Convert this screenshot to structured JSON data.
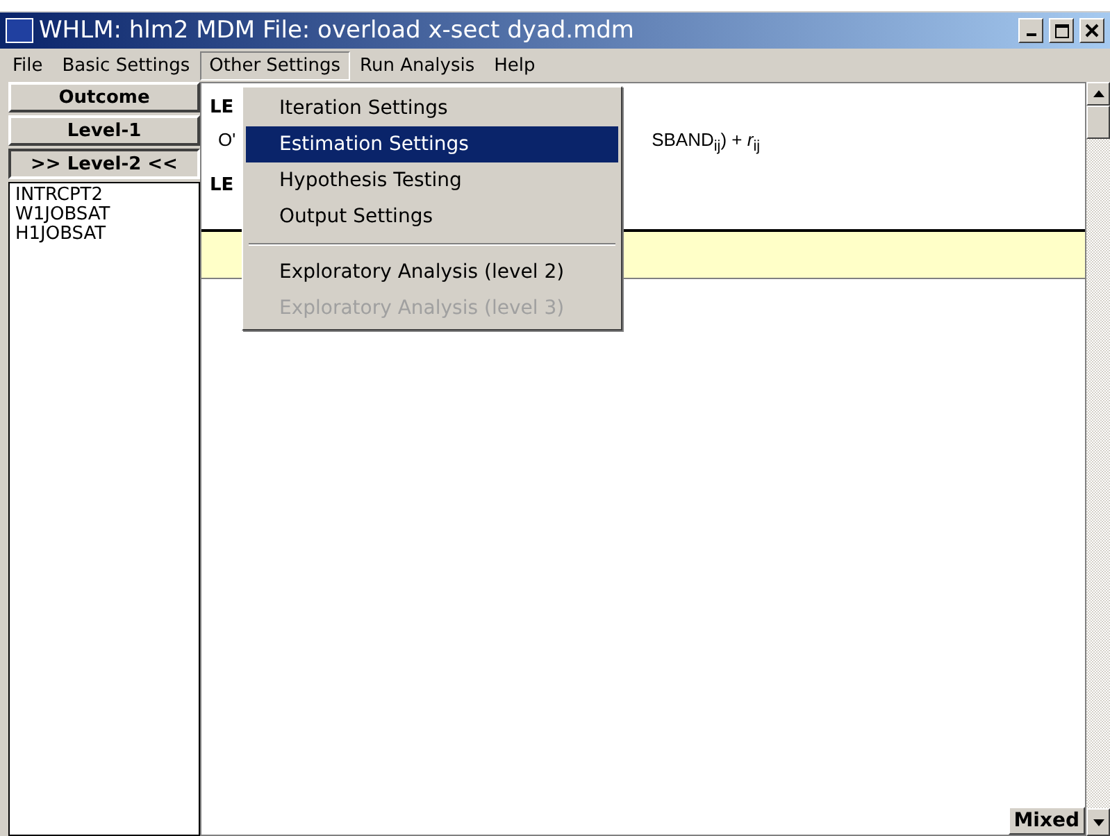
{
  "window": {
    "title": "WHLM: hlm2 MDM File: overload x-sect dyad.mdm"
  },
  "menu_bar": [
    {
      "label": "File",
      "selected": false
    },
    {
      "label": "Basic Settings",
      "selected": false
    },
    {
      "label": "Other Settings",
      "selected": true
    },
    {
      "label": "Run Analysis",
      "selected": false
    },
    {
      "label": "Help",
      "selected": false
    }
  ],
  "dropdown": [
    {
      "kind": "item",
      "label": "Iteration Settings",
      "selected": false,
      "disabled": false
    },
    {
      "kind": "item",
      "label": "Estimation Settings",
      "selected": true,
      "disabled": false
    },
    {
      "kind": "item",
      "label": "Hypothesis Testing",
      "selected": false,
      "disabled": false
    },
    {
      "kind": "item",
      "label": "Output Settings",
      "selected": false,
      "disabled": false
    },
    {
      "kind": "separator"
    },
    {
      "kind": "item",
      "label": "Exploratory Analysis (level 2)",
      "selected": false,
      "disabled": false
    },
    {
      "kind": "item",
      "label": "Exploratory Analysis (level 3)",
      "selected": false,
      "disabled": true
    }
  ],
  "level_buttons": [
    {
      "label": "Outcome",
      "selected": false
    },
    {
      "label": "Level-1",
      "selected": false
    },
    {
      "label": ">> Level-2 <<",
      "selected": true
    }
  ],
  "variables": [
    "INTRCPT2",
    "W1JOBSAT",
    "H1JOBSAT"
  ],
  "model": {
    "heading_1": "LE",
    "equation_start": "O'",
    "equation_end": "SBAND$_{ij}$) + *r*$_{ij}$",
    "heading_2": "LE"
  },
  "mode_button": "Mixed"
}
